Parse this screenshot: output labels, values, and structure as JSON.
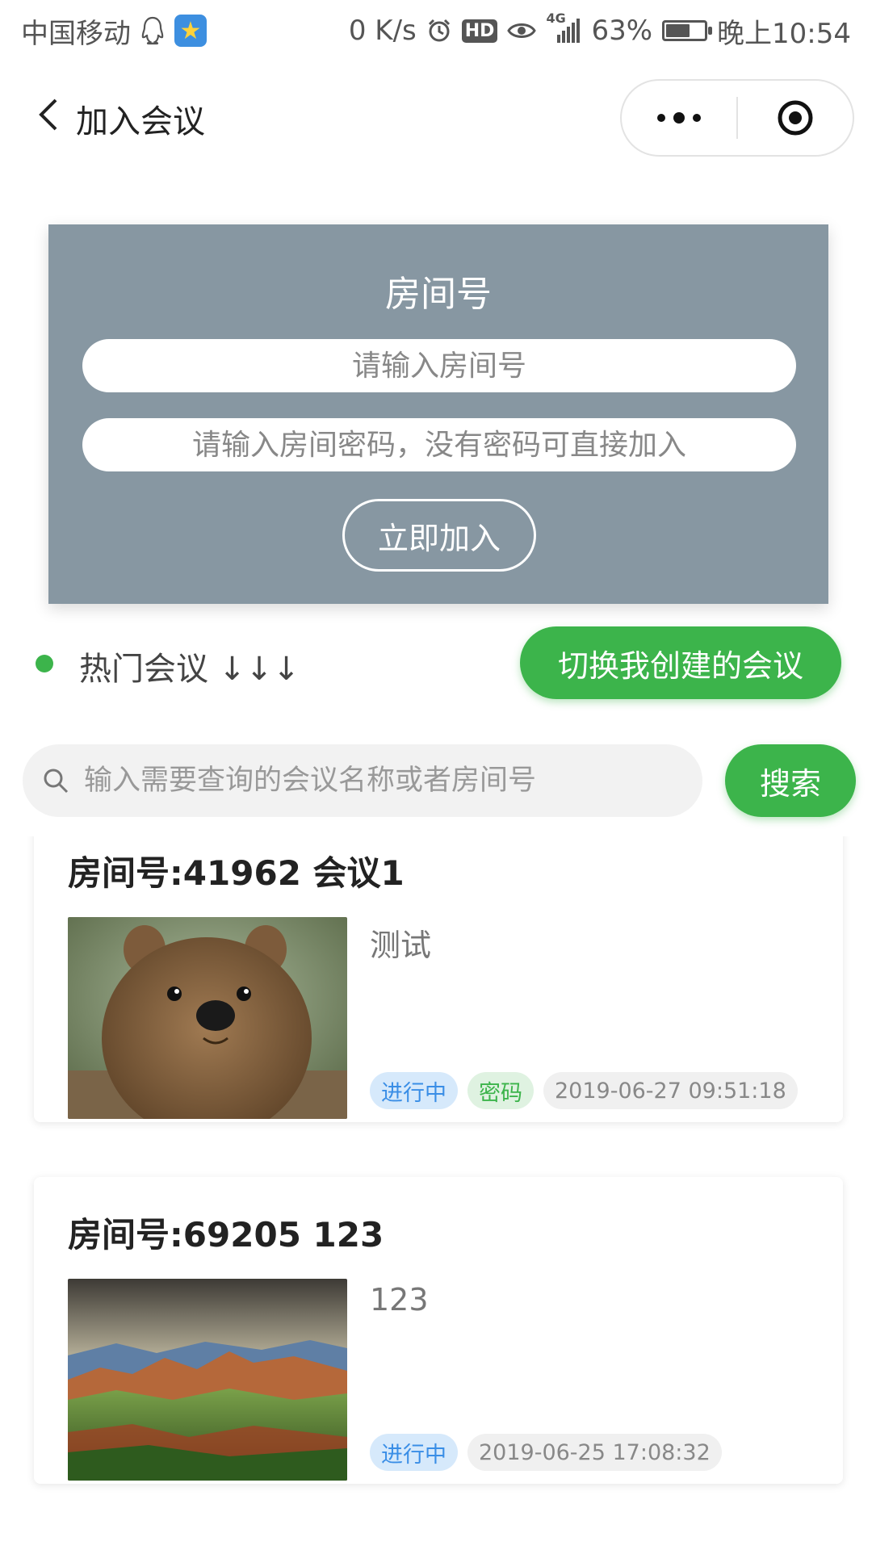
{
  "status_bar": {
    "carrier": "中国移动",
    "speed": "0 K/s",
    "hd": "HD",
    "signal": "4G",
    "battery_percent": "63%",
    "battery_level": 0.63,
    "time": "晚上10:54"
  },
  "nav": {
    "title": "加入会议"
  },
  "join_panel": {
    "title": "房间号",
    "room_placeholder": "请输入房间号",
    "password_placeholder": "请输入房间密码，没有密码可直接加入",
    "join_button": "立即加入"
  },
  "hot": {
    "label": "热门会议 ↓↓↓",
    "switch_button": "切换我创建的会议"
  },
  "search": {
    "placeholder": "输入需要查询的会议名称或者房间号",
    "button": "搜索"
  },
  "meetings": [
    {
      "title": "房间号:41962 会议1",
      "description": "测试",
      "status": "进行中",
      "password_tag": "密码",
      "time": "2019-06-27 09:51:18"
    },
    {
      "title": "房间号:69205 123",
      "description": "123",
      "status": "进行中",
      "time": "2019-06-25 17:08:32"
    }
  ],
  "colors": {
    "accent": "#3cb44b",
    "panel": "#8797a2",
    "tag_blue": "#3a8ee6"
  }
}
